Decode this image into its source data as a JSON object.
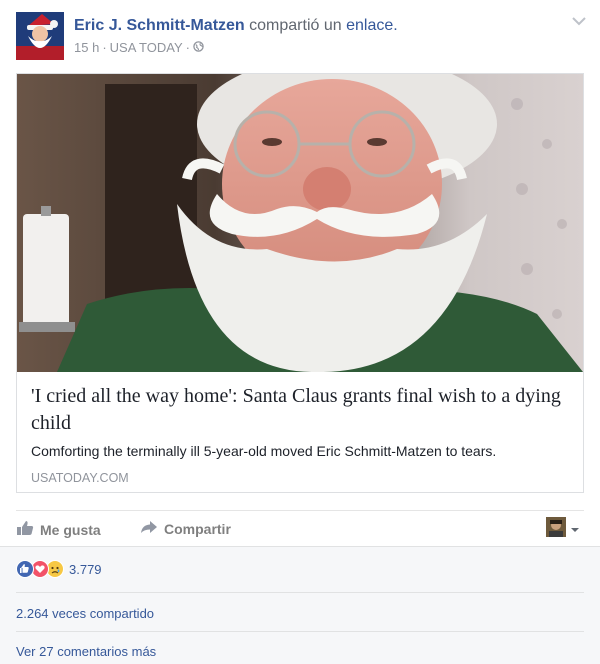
{
  "post": {
    "author": "Eric J. Schmitt-Matzen",
    "action_text": "compartió un",
    "action_link": "enlace.",
    "time": "15 h",
    "source": "USA TODAY",
    "options_icon": "chevron-down-icon",
    "privacy_icon": "globe-icon"
  },
  "link": {
    "headline": "'I cried all the way home': Santa Claus grants final wish to a dying child",
    "description": "Comforting the terminally ill 5-year-old moved Eric Schmitt-Matzen to tears.",
    "domain": "USATODAY.COM"
  },
  "actions": {
    "like_label": "Me gusta",
    "share_label": "Compartir"
  },
  "footer": {
    "reaction_count": "3.779",
    "reactions": [
      "like",
      "love",
      "sad"
    ],
    "shares": "2.264 veces compartido",
    "comments": "Ver 27 comentarios más"
  },
  "colors": {
    "link_blue": "#365899",
    "like_blue": "#4267b2",
    "love_red": "#f25268",
    "sad_yellow": "#f7c844",
    "muted_gray": "#90949c",
    "footer_bg": "#f6f7f9"
  }
}
